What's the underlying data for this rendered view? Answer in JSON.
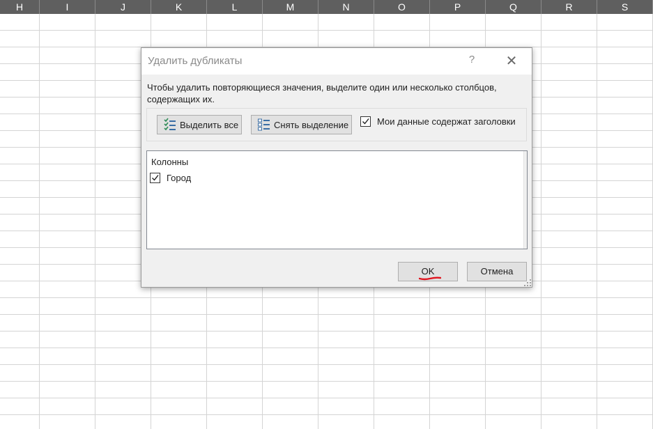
{
  "spreadsheet": {
    "columns": [
      "H",
      "I",
      "J",
      "K",
      "L",
      "M",
      "N",
      "O",
      "P",
      "Q",
      "R",
      "S"
    ]
  },
  "dialog": {
    "title": "Удалить дубликаты",
    "help_label": "?",
    "close_label": "✕",
    "description": "Чтобы удалить повторяющиеся значения, выделите один или несколько столбцов, содержащих их.",
    "select_all_label": "Выделить все",
    "unselect_all_label": "Снять выделение",
    "headers_checkbox": {
      "label": "Мои данные содержат заголовки",
      "checked": true
    },
    "list": {
      "header": "Колонны",
      "items": [
        {
          "label": "Город",
          "checked": true
        }
      ]
    },
    "ok_label": "OK",
    "cancel_label": "Отмена",
    "colors": {
      "annotation": "#e0141e",
      "icon_green": "#2e8b57",
      "icon_blue": "#3a6ea5"
    }
  }
}
